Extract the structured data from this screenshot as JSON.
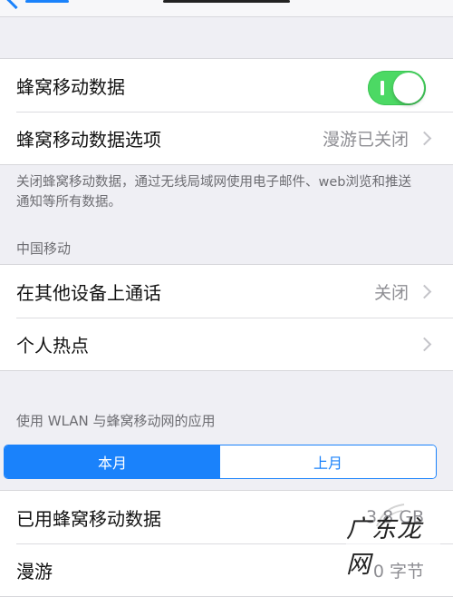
{
  "cellular_group": {
    "toggle_row": {
      "label": "蜂窝移动数据",
      "enabled": true
    },
    "options_row": {
      "label": "蜂窝移动数据选项",
      "value": "漫游已关闭"
    }
  },
  "note": "关闭蜂窝移动数据，通过无线局域网使用电子邮件、web浏览和推送通知等所有数据。",
  "carrier_section": {
    "header": "中国移动",
    "rows": [
      {
        "label": "在其他设备上通话",
        "value": "关闭"
      },
      {
        "label": "个人热点",
        "value": ""
      }
    ]
  },
  "usage_section": {
    "header": "使用 WLAN 与蜂窝移动网的应用",
    "segments": [
      {
        "label": "本月",
        "active": true
      },
      {
        "label": "上月",
        "active": false
      }
    ],
    "rows": [
      {
        "label": "已用蜂窝移动数据",
        "value": "3.8 GB"
      },
      {
        "label": "漫游",
        "value": "0 字节"
      }
    ]
  },
  "watermark": "广东龙网",
  "colors": {
    "accent": "#1a82fb",
    "toggle_on": "#4cd964",
    "background": "#efeff4",
    "secondary_text": "#8e8e93"
  }
}
